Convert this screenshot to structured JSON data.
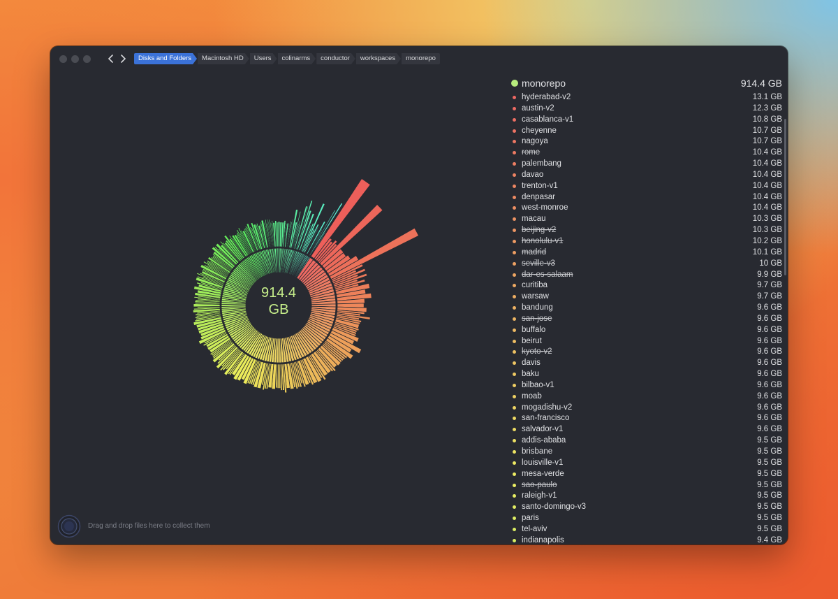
{
  "breadcrumb": [
    "Disks and Folders",
    "Macintosh HD",
    "Users",
    "colinarms",
    "conductor",
    "workspaces",
    "monorepo"
  ],
  "center": {
    "value": "914.4",
    "unit": "GB"
  },
  "root": {
    "name": "monorepo",
    "size": "914.4 GB",
    "color": "#b7ec7d"
  },
  "collector": {
    "text": "Drag and drop files here to collect them"
  },
  "items": [
    {
      "name": "hyderabad-v2",
      "size": "13.1 GB",
      "deleted": false
    },
    {
      "name": "austin-v2",
      "size": "12.3 GB",
      "deleted": false
    },
    {
      "name": "casablanca-v1",
      "size": "10.8 GB",
      "deleted": false
    },
    {
      "name": "cheyenne",
      "size": "10.7 GB",
      "deleted": false
    },
    {
      "name": "nagoya",
      "size": "10.7 GB",
      "deleted": false
    },
    {
      "name": "rome",
      "size": "10.4 GB",
      "deleted": true
    },
    {
      "name": "palembang",
      "size": "10.4 GB",
      "deleted": false
    },
    {
      "name": "davao",
      "size": "10.4 GB",
      "deleted": false
    },
    {
      "name": "trenton-v1",
      "size": "10.4 GB",
      "deleted": false
    },
    {
      "name": "denpasar",
      "size": "10.4 GB",
      "deleted": false
    },
    {
      "name": "west-monroe",
      "size": "10.4 GB",
      "deleted": false
    },
    {
      "name": "macau",
      "size": "10.3 GB",
      "deleted": false
    },
    {
      "name": "beijing-v2",
      "size": "10.3 GB",
      "deleted": true
    },
    {
      "name": "honolulu-v1",
      "size": "10.2 GB",
      "deleted": true
    },
    {
      "name": "madrid",
      "size": "10.1 GB",
      "deleted": true
    },
    {
      "name": "seville-v3",
      "size": "10    GB",
      "deleted": true
    },
    {
      "name": "dar-es-salaam",
      "size": "9.9 GB",
      "deleted": true
    },
    {
      "name": "curitiba",
      "size": "9.7 GB",
      "deleted": false
    },
    {
      "name": "warsaw",
      "size": "9.7 GB",
      "deleted": false
    },
    {
      "name": "bandung",
      "size": "9.6 GB",
      "deleted": false
    },
    {
      "name": "san-jose",
      "size": "9.6 GB",
      "deleted": true
    },
    {
      "name": "buffalo",
      "size": "9.6 GB",
      "deleted": false
    },
    {
      "name": "beirut",
      "size": "9.6 GB",
      "deleted": false
    },
    {
      "name": "kyoto-v2",
      "size": "9.6 GB",
      "deleted": true
    },
    {
      "name": "davis",
      "size": "9.6 GB",
      "deleted": false
    },
    {
      "name": "baku",
      "size": "9.6 GB",
      "deleted": false
    },
    {
      "name": "bilbao-v1",
      "size": "9.6 GB",
      "deleted": false
    },
    {
      "name": "moab",
      "size": "9.6 GB",
      "deleted": false
    },
    {
      "name": "mogadishu-v2",
      "size": "9.6 GB",
      "deleted": false
    },
    {
      "name": "san-francisco",
      "size": "9.6 GB",
      "deleted": false
    },
    {
      "name": "salvador-v1",
      "size": "9.6 GB",
      "deleted": false
    },
    {
      "name": "addis-ababa",
      "size": "9.5 GB",
      "deleted": false
    },
    {
      "name": "brisbane",
      "size": "9.5 GB",
      "deleted": false
    },
    {
      "name": "louisville-v1",
      "size": "9.5 GB",
      "deleted": false
    },
    {
      "name": "mesa-verde",
      "size": "9.5 GB",
      "deleted": false
    },
    {
      "name": "sao-paulo",
      "size": "9.5 GB",
      "deleted": true
    },
    {
      "name": "raleigh-v1",
      "size": "9.5 GB",
      "deleted": false
    },
    {
      "name": "santo-domingo-v3",
      "size": "9.5 GB",
      "deleted": false
    },
    {
      "name": "paris",
      "size": "9.5 GB",
      "deleted": false
    },
    {
      "name": "tel-aviv",
      "size": "9.5 GB",
      "deleted": false
    },
    {
      "name": "indianapolis",
      "size": "9.4 GB",
      "deleted": false
    }
  ]
}
